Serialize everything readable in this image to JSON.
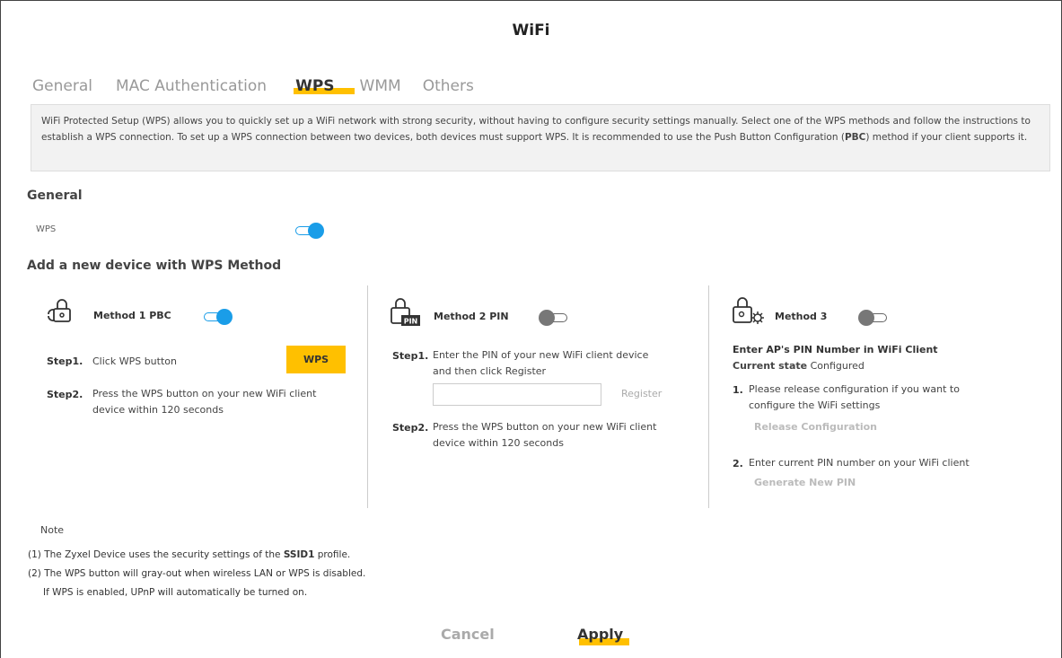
{
  "page": {
    "title": "WiFi"
  },
  "tabs": [
    {
      "label": "General",
      "active": false
    },
    {
      "label": "MAC Authentication",
      "active": false
    },
    {
      "label": "WPS",
      "active": true
    },
    {
      "label": "WMM",
      "active": false
    },
    {
      "label": "Others",
      "active": false
    }
  ],
  "description": {
    "part1": "WiFi Protected Setup (WPS) allows you to quickly set up a WiFi network with strong security, without having to configure security settings manually. Select one of the WPS methods and follow the instructions to establish a WPS connection. To set up a WPS connection between two devices, both devices must support WPS. It is recommended to use the Push Button Configuration (",
    "bold": "PBC",
    "part2": ") method if your client supports it."
  },
  "general": {
    "heading": "General",
    "wps_label": "WPS",
    "wps_enabled": true
  },
  "add_device": {
    "heading": "Add a new device with WPS Method"
  },
  "method1": {
    "title": "Method 1 PBC",
    "enabled": true,
    "step1_label": "Step1.",
    "step1_text": "Click WPS button",
    "wps_button": "WPS",
    "step2_label": "Step2.",
    "step2_text_line1": "Press the WPS button on your new WiFi client",
    "step2_text_line2": "device within 120 seconds"
  },
  "method2": {
    "title": "Method 2 PIN",
    "enabled": false,
    "icon_text": "PIN",
    "step1_label": "Step1.",
    "step1_text_line1": "Enter the PIN of your new WiFi client device",
    "step1_text_line2": "and then click Register",
    "pin_value": "",
    "register_button": "Register",
    "step2_label": "Step2.",
    "step2_text_line1": "Press the WPS button on your new WiFi client",
    "step2_text_line2": "device within 120 seconds"
  },
  "method3": {
    "title": "Method 3",
    "enabled": false,
    "heading": "Enter AP's PIN Number in WiFi Client",
    "state_label": "Current state",
    "state_value": "Configured",
    "item1_num": "1.",
    "item1_line1": "Please release configuration if you want to",
    "item1_line2": "configure the WiFi settings",
    "release_button": "Release Configuration",
    "item2_num": "2.",
    "item2_text": "Enter current PIN number on your WiFi client",
    "generate_button": "Generate New PIN"
  },
  "notes": {
    "heading": "Note",
    "line1_part1": "(1) The Zyxel Device uses the security settings of the ",
    "line1_bold": "SSID1",
    "line1_part2": " profile.",
    "line2": "(2) The WPS button will gray-out when wireless LAN or WPS is disabled.",
    "line3": "If WPS is enabled, UPnP will automatically be turned on."
  },
  "footer": {
    "cancel": "Cancel",
    "apply": "Apply"
  },
  "colors": {
    "accent": "#ffc000",
    "toggle_on": "#1a9de8",
    "toggle_off": "#777777",
    "desc_bg": "#f2f2f2"
  }
}
